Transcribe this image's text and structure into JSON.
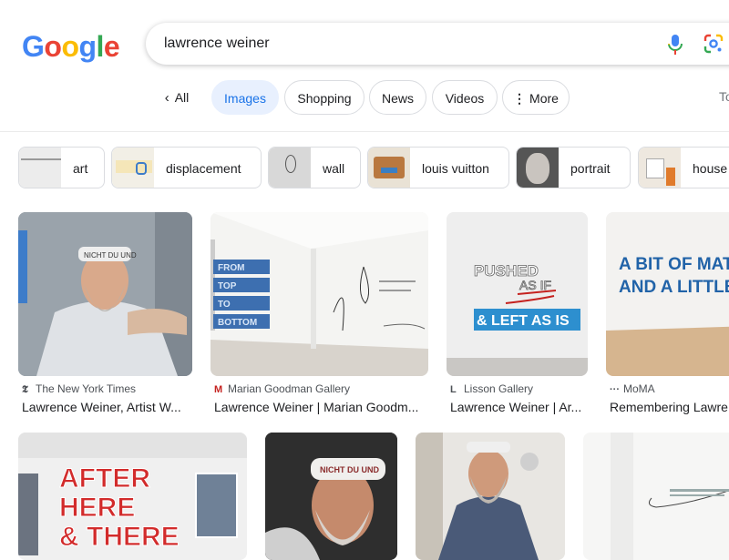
{
  "logo": {
    "letters": [
      "G",
      "o",
      "o",
      "g",
      "l",
      "e"
    ],
    "colors": [
      "#4285f4",
      "#ea4335",
      "#fbbc05",
      "#4285f4",
      "#34a853",
      "#ea4335"
    ]
  },
  "search": {
    "query": "lawrence weiner"
  },
  "tabs": {
    "all": "All",
    "images": "Images",
    "shopping": "Shopping",
    "news": "News",
    "videos": "Videos",
    "more": "More",
    "tools": "To"
  },
  "chips": [
    "art",
    "displacement",
    "wall",
    "louis vuitton",
    "portrait",
    "house"
  ],
  "results_row1": [
    {
      "source": "The New York Times",
      "favicon": "𝕿",
      "title": "Lawrence Weiner, Artist W..."
    },
    {
      "source": "Marian Goodman Gallery",
      "favicon": "M",
      "title": "Lawrence Weiner | Marian Goodm..."
    },
    {
      "source": "Lisson Gallery",
      "favicon": "L",
      "title": "Lawrence Weiner | Ar..."
    },
    {
      "source": "MoMA",
      "favicon": "···",
      "title": "Remembering Lawre"
    }
  ],
  "artwork_text": {
    "from_top": [
      "FROM",
      "TOP",
      "TO",
      "BOTTOM"
    ],
    "pushed": [
      "PUSHED",
      "AS IF",
      "& LEFT AS IS"
    ],
    "bit_of_matter": [
      "A BIT OF MATTE",
      "AND A LITTLE"
    ],
    "after_here": [
      "AFTER",
      "HERE",
      "& THERE"
    ],
    "hat_text": "NICHT DU UND"
  },
  "colors": {
    "accent": "#1a73e8",
    "active_tab_bg": "#e8f0fe"
  }
}
